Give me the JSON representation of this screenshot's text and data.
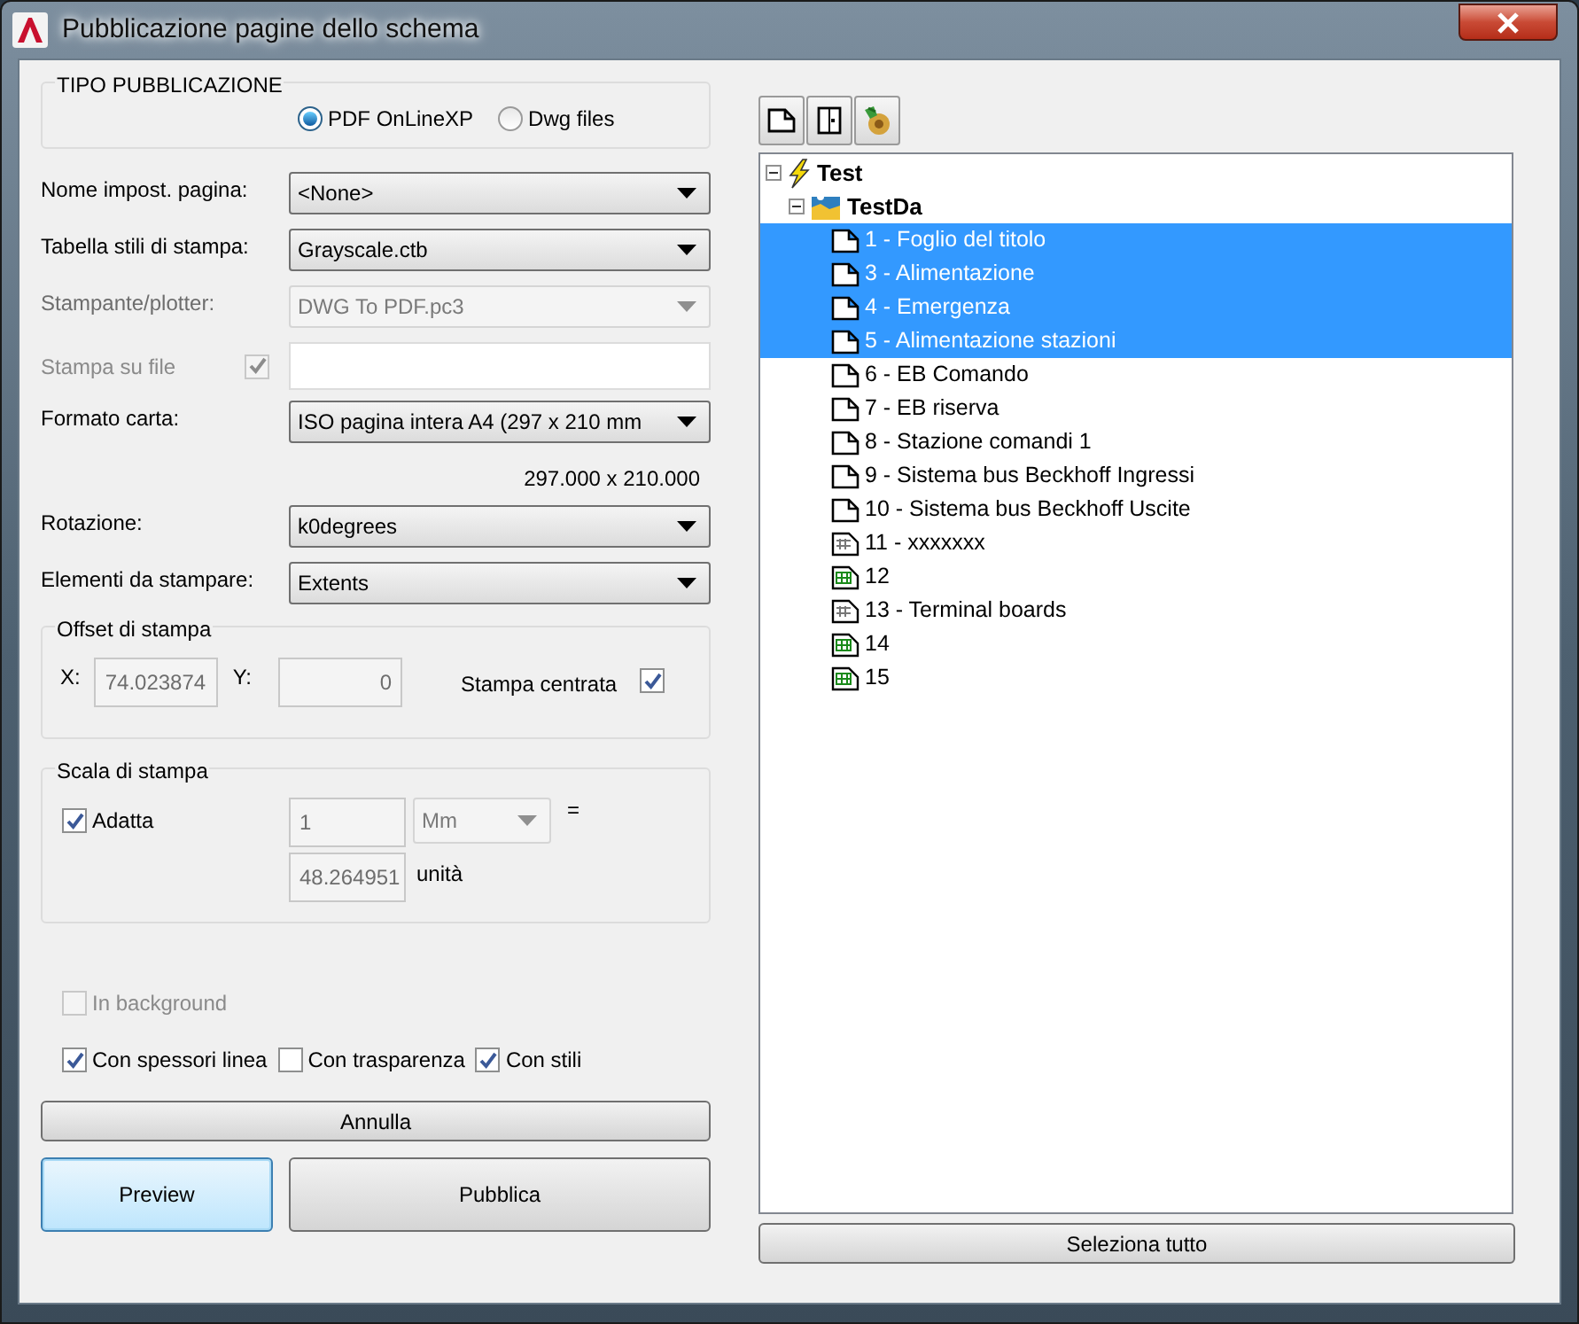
{
  "window": {
    "title": "Pubblicazione pagine dello schema"
  },
  "publish_type": {
    "title": "TIPO PUBBLICAZIONE",
    "options": [
      {
        "label": "PDF OnLineXP",
        "selected": true
      },
      {
        "label": "Dwg files",
        "selected": false
      }
    ]
  },
  "fields": [
    {
      "kind": "dropdown",
      "label": "Nome impost. pagina:",
      "value": "<None>",
      "disabled": false
    },
    {
      "kind": "dropdown",
      "label": "Tabella stili di stampa:",
      "value": "Grayscale.ctb",
      "disabled": false
    },
    {
      "kind": "dropdown",
      "label": "Stampante/plotter:",
      "value": "DWG To PDF.pc3",
      "disabled": true
    },
    {
      "kind": "checkfield",
      "label": "Stampa su file",
      "checked": true,
      "disabled": true
    },
    {
      "kind": "dropdown",
      "label": "Formato carta:",
      "value": "ISO pagina intera A4 (297 x 210 mm",
      "disabled": false
    },
    {
      "kind": "note",
      "value": "297.000 x 210.000"
    },
    {
      "kind": "dropdown",
      "label": "Rotazione:",
      "value": "k0degrees",
      "disabled": false
    },
    {
      "kind": "dropdown",
      "label": "Elementi da stampare:",
      "value": "Extents",
      "disabled": false
    }
  ],
  "offset": {
    "title": "Offset di stampa",
    "x_label": "X:",
    "x_value": "74.023874",
    "y_label": "Y:",
    "y_value": "0",
    "center_label": "Stampa centrata",
    "center_checked": true
  },
  "scale": {
    "title": "Scala di stampa",
    "fit_label": "Adatta",
    "fit_checked": true,
    "value": "1",
    "unit": "Mm",
    "equals": "=",
    "result": "48.264951",
    "result_unit": "unità"
  },
  "options": [
    {
      "label": "In background",
      "checked": false,
      "disabled": true
    },
    {
      "label": "Con spessori linea",
      "checked": true,
      "disabled": false
    },
    {
      "label": "Con trasparenza",
      "checked": false,
      "disabled": false
    },
    {
      "label": "Con stili",
      "checked": true,
      "disabled": false
    }
  ],
  "buttons": {
    "cancel": "Annulla",
    "preview": "Preview",
    "publish": "Pubblica"
  },
  "tree": [
    {
      "label": "Test",
      "kind": "project",
      "expanded": true,
      "selected": false,
      "children": [
        {
          "label": "TestDa",
          "kind": "folder",
          "expanded": true,
          "selected": false,
          "children": [
            {
              "label": "1 - Foglio del titolo",
              "kind": "page",
              "selected": true
            },
            {
              "label": "3 - Alimentazione",
              "kind": "page",
              "selected": true
            },
            {
              "label": "4 - Emergenza",
              "kind": "page",
              "selected": true
            },
            {
              "label": "5 - Alimentazione stazioni",
              "kind": "page",
              "selected": true
            },
            {
              "label": "6 - EB Comando",
              "kind": "page",
              "selected": false
            },
            {
              "label": "7 - EB riserva",
              "kind": "page",
              "selected": false
            },
            {
              "label": "8 - Stazione comandi 1",
              "kind": "page",
              "selected": false
            },
            {
              "label": "9 - Sistema bus Beckhoff Ingressi",
              "kind": "page",
              "selected": false
            },
            {
              "label": "10 - Sistema bus Beckhoff Uscite",
              "kind": "page",
              "selected": false
            },
            {
              "label": "11 - xxxxxxx",
              "kind": "terminal",
              "selected": false
            },
            {
              "label": "12",
              "kind": "table",
              "selected": false
            },
            {
              "label": "13 - Terminal boards",
              "kind": "terminal",
              "selected": false
            },
            {
              "label": "14",
              "kind": "table",
              "selected": false
            },
            {
              "label": "15",
              "kind": "table",
              "selected": false
            }
          ]
        }
      ]
    }
  ],
  "select_all": "Seleziona tutto"
}
